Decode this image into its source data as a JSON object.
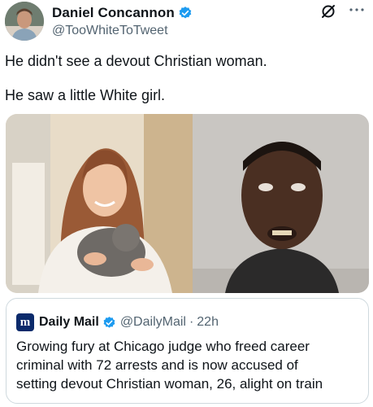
{
  "author": {
    "name": "Daniel Concannon",
    "handle": "@TooWhiteToTweet"
  },
  "tweet": {
    "lines": [
      "He didn't see a devout Christian woman.",
      "He saw a little White girl."
    ]
  },
  "media": {
    "count": 2
  },
  "quoted": {
    "logo_letter": "m",
    "name": "Daily Mail",
    "handle": "@DailyMail",
    "separator": "·",
    "time": "22h",
    "body_lines": [
      "Growing fury at Chicago judge who freed career",
      "criminal with 72 arrests and is now accused of",
      "setting devout Christian woman, 26, alight on train"
    ]
  },
  "icons": {
    "verified": "verified-badge-icon",
    "grok": "grok-icon",
    "more": "more-icon"
  },
  "colors": {
    "verified_blue": "#1d9bf0",
    "secondary_text": "#536471",
    "border": "#cfd9de",
    "daily_mail_logo": "#0b2a6b"
  }
}
